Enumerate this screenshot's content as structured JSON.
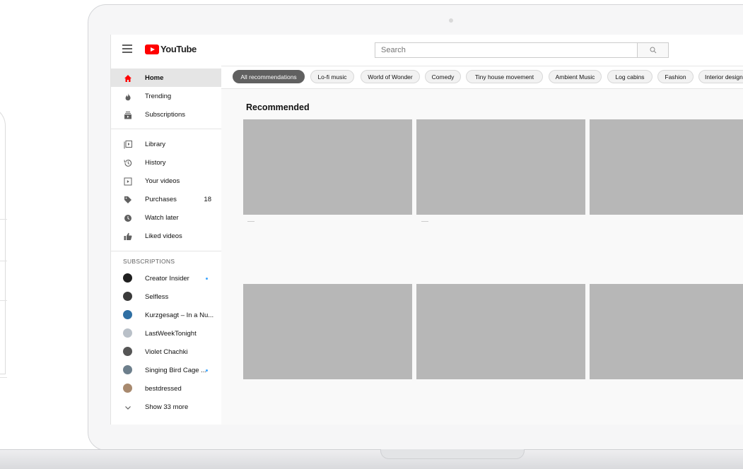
{
  "app": {
    "logo_text": "YouTube"
  },
  "search": {
    "placeholder": "Search"
  },
  "sidebar": {
    "main": [
      {
        "label": "Home",
        "icon": "home-icon",
        "active": true
      },
      {
        "label": "Trending",
        "icon": "flame-icon"
      },
      {
        "label": "Subscriptions",
        "icon": "subscriptions-icon"
      }
    ],
    "library": [
      {
        "label": "Library",
        "icon": "library-icon"
      },
      {
        "label": "History",
        "icon": "history-icon"
      },
      {
        "label": "Your videos",
        "icon": "your-videos-icon"
      },
      {
        "label": "Purchases",
        "icon": "tag-icon",
        "count": "18"
      },
      {
        "label": "Watch later",
        "icon": "clock-icon"
      },
      {
        "label": "Liked videos",
        "icon": "thumbs-up-icon"
      }
    ],
    "subscriptions_title": "SUBSCRIPTIONS",
    "subscriptions": [
      {
        "label": "Creator Insider",
        "new": true,
        "color": "#1f1f1f"
      },
      {
        "label": "Selfless",
        "new": false,
        "color": "#3a3a3a"
      },
      {
        "label": "Kurzgesagt – In a Nu...",
        "new": false,
        "color": "#2f6fa3"
      },
      {
        "label": "LastWeekTonight",
        "new": false,
        "color": "#b9c0c8"
      },
      {
        "label": "Violet Chachki",
        "new": false,
        "color": "#555555"
      },
      {
        "label": "Singing Bird Cage ...",
        "new": true,
        "color": "#6d7f8c"
      },
      {
        "label": "bestdressed",
        "new": false,
        "color": "#a8896e"
      }
    ],
    "show_more": "Show 33 more"
  },
  "chips": [
    "All recommendations",
    "Lo-fi music",
    "World of Wonder",
    "Comedy",
    "Tiny house movement",
    "Ambient Music",
    "Log cabins",
    "Fashion",
    "Interior design"
  ],
  "main": {
    "section_title": "Recommended"
  },
  "colors": {
    "accent": "#ff0000",
    "thumbnail": "#b7b7b7",
    "active_chip": "#606060",
    "new_dot": "#3ea6ff"
  }
}
